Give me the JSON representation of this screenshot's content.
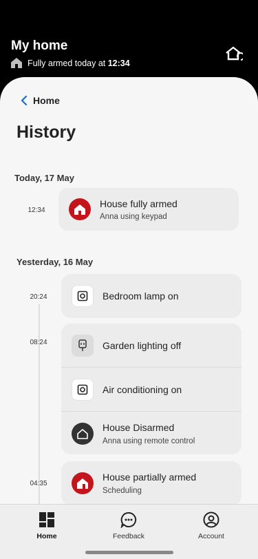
{
  "header": {
    "title": "My home",
    "status_prefix": "Fully armed today at ",
    "status_time": "12:34",
    "home_icon": "house-icon",
    "action_icon": "house-arm-toggle-icon"
  },
  "nav_back": {
    "label": "Home"
  },
  "page": {
    "title": "History"
  },
  "sections": [
    {
      "date": "Today, 17 May",
      "events": [
        {
          "time": "12:34",
          "title": "House fully armed",
          "subtitle": "Anna using keypad",
          "icon": "house-armed-icon",
          "icon_color": "#c4141c"
        }
      ]
    },
    {
      "date": "Yesterday, 16 May",
      "events": [
        {
          "time": "20:24",
          "title": "Bedroom lamp on",
          "icon": "smart-plug-icon"
        },
        {
          "time": "08:24",
          "title": "Garden lighting off",
          "icon": "plug-off-icon"
        },
        {
          "title": "Air conditioning on",
          "icon": "smart-plug-icon"
        },
        {
          "title": "House Disarmed",
          "subtitle": "Anna using remote control",
          "icon": "house-disarmed-icon",
          "icon_color": "#333333"
        },
        {
          "time": "04:35",
          "title": "House partially armed",
          "subtitle": "Scheduling",
          "icon": "house-partial-icon",
          "icon_color": "#c4141c"
        }
      ]
    }
  ],
  "bottom_nav": [
    {
      "label": "Home",
      "icon": "dashboard-icon",
      "active": true
    },
    {
      "label": "Feedback",
      "icon": "chat-icon",
      "active": false
    },
    {
      "label": "Account",
      "icon": "user-icon",
      "active": false
    }
  ]
}
